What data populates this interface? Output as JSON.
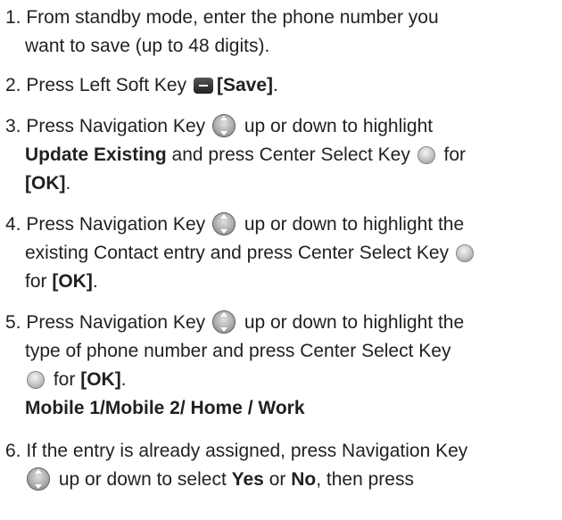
{
  "steps": [
    {
      "num": "1.",
      "l1": "From standby mode, enter the phone number you",
      "l2": "want to save (up to 48 digits)."
    },
    {
      "num": "2.",
      "a": "Press Left Soft Key",
      "b": "[Save]",
      "c": "."
    },
    {
      "num": "3.",
      "a": "Press Navigation Key",
      "b": "up or down to highlight",
      "c": "Update Existing",
      "d": "and press Center Select Key",
      "e": "for",
      "f": "[OK]",
      "g": "."
    },
    {
      "num": "4.",
      "a": "Press Navigation Key",
      "b": "up or down to highlight the",
      "c": "existing Contact entry and press Center Select Key",
      "d": "for",
      "e": "[OK]",
      "f": "."
    },
    {
      "num": "5.",
      "a": "Press Navigation Key",
      "b": "up or down to highlight the",
      "c": "type of phone number and press Center Select Key",
      "d": "for",
      "e": "[OK]",
      "f": ".",
      "g": "Mobile 1/Mobile 2/ Home / Work"
    },
    {
      "num": "6.",
      "a": "If the entry is already assigned, press Navigation Key",
      "b": "up or down to select",
      "c": "Yes",
      "d": "or",
      "e": "No",
      "f": ", then press"
    }
  ],
  "icons": {
    "left_soft_key": "left-soft-key-icon",
    "navigation_key": "navigation-key-icon",
    "center_select_key": "center-select-key-icon"
  }
}
